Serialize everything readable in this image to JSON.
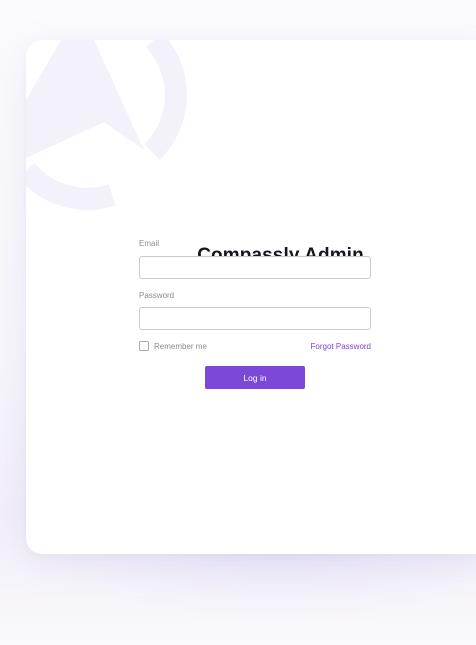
{
  "app": {
    "title": "Compassly Admin"
  },
  "form": {
    "email_label": "Email",
    "email_value": "",
    "email_placeholder": "",
    "password_label": "Password",
    "password_value": "",
    "password_placeholder": "",
    "remember_label": "Remember me",
    "remember_checked": false,
    "forgot_label": "Forgot Password",
    "login_label": "Log in"
  },
  "icons": {
    "logo": "compass-logo-icon",
    "checkbox": "checkbox-icon"
  },
  "colors": {
    "accent": "#7c48d8",
    "link": "#7c42d6",
    "title": "#16161d",
    "label": "#8b8b95",
    "logo_tint": "#f3f1fa"
  }
}
